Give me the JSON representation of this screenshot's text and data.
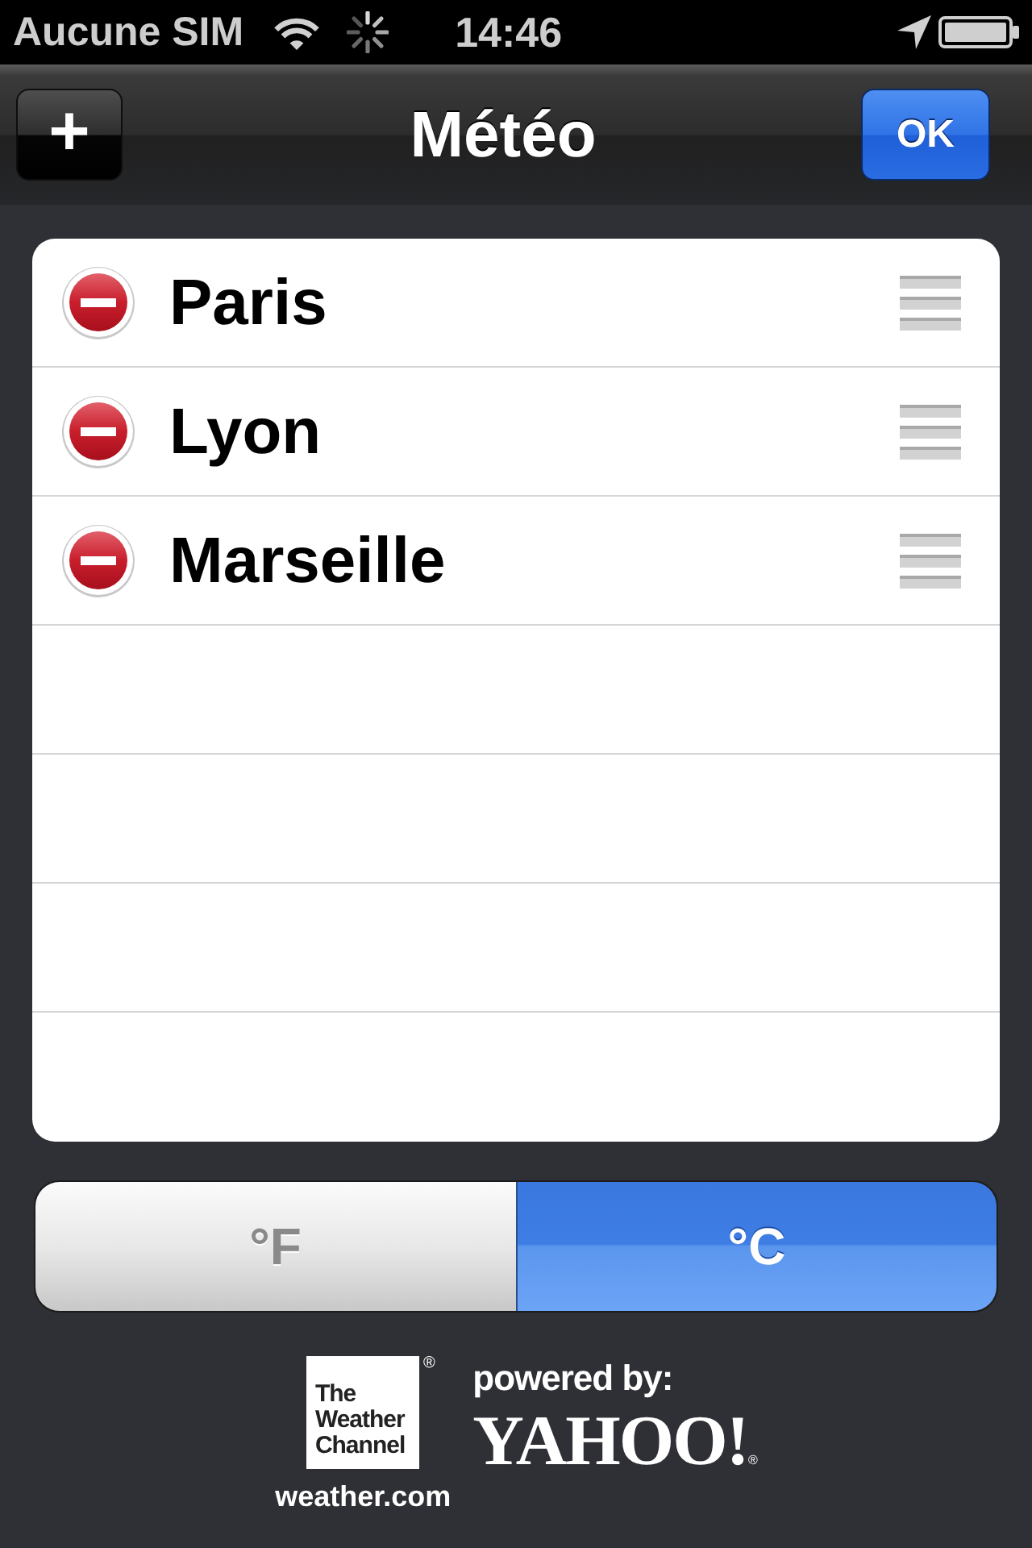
{
  "status_bar": {
    "carrier": "Aucune SIM",
    "time": "14:46"
  },
  "nav_bar": {
    "add_button": "+",
    "title": "Météo",
    "done_button": "OK"
  },
  "cities": [
    {
      "name": "Paris"
    },
    {
      "name": "Lyon"
    },
    {
      "name": "Marseille"
    }
  ],
  "units": [
    {
      "label": "°F",
      "selected": false
    },
    {
      "label": "°C",
      "selected": true
    }
  ],
  "credits": {
    "weather_channel": {
      "logo_text": "The Weather Channel",
      "registered_mark": "®",
      "site": "weather.com"
    },
    "yahoo": {
      "caption": "powered by:",
      "logo_text": "YAHOO!",
      "registered_mark": "®"
    }
  }
}
